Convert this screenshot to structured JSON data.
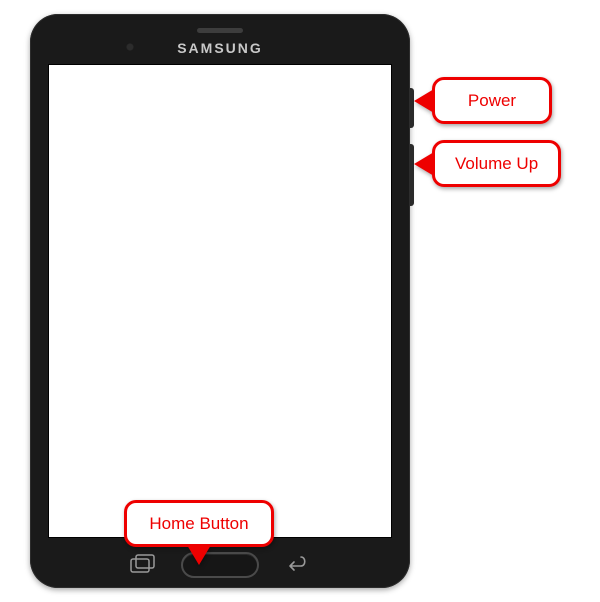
{
  "device": {
    "brand": "SAMSUNG"
  },
  "callouts": {
    "power": "Power",
    "volume": "Volume Up",
    "home": "Home Button"
  }
}
